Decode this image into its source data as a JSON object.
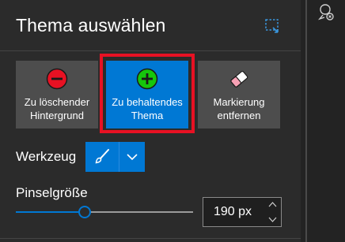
{
  "panel": {
    "title": "Thema auswählen"
  },
  "tiles": [
    {
      "label": "Zu löschender\nHintergrund",
      "icon": "minus-circle-icon",
      "icon_color": "#e81123",
      "selected": false
    },
    {
      "label": "Zu behaltendes\nThema",
      "icon": "plus-circle-icon",
      "icon_color": "#16c60c",
      "selected": true
    },
    {
      "label": "Markierung\nentfernen",
      "icon": "eraser-icon",
      "icon_color": "#f7b7c4",
      "selected": false
    }
  ],
  "tool": {
    "label": "Werkzeug",
    "selected_icon": "brush-icon"
  },
  "brush_size": {
    "label": "Pinselgröße",
    "value_text": "190 px",
    "slider_fraction": 0.39
  },
  "colors": {
    "accent": "#0078d4",
    "selection_outline": "#e81123",
    "background": "#2b2b2b",
    "tile": "#4d4d4d"
  }
}
